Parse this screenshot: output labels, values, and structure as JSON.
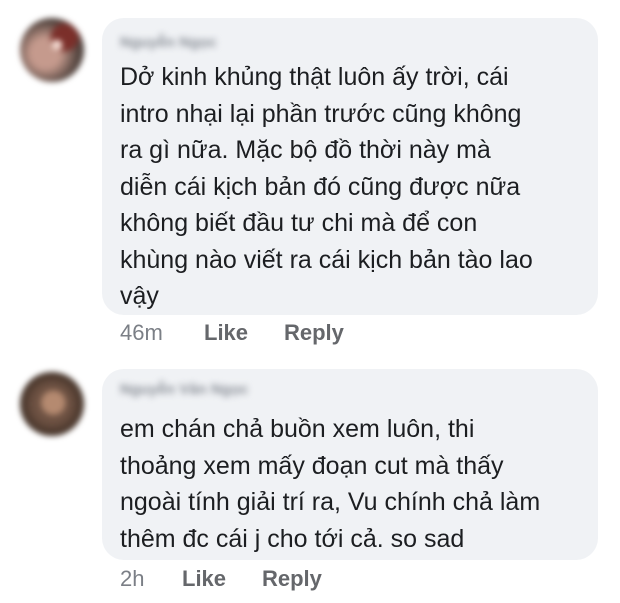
{
  "comments": [
    {
      "author": "Nguyễn Ngọc",
      "text": "Dở kinh khủng thật luôn ấy trời, cái\nintro nhại lại phần trước cũng không\nra gì nữa. Mặc bộ đồ thời này mà\ndiễn cái kịch bản đó cũng được nữa\nkhông biết đầu tư chi mà để con\nkhùng nào viết ra cái kịch bản tào lao\nvậy",
      "time": "46m",
      "like_label": "Like",
      "reply_label": "Reply"
    },
    {
      "author": "Nguyễn Văn Ngọc",
      "text": "em chán chả buồn xem luôn, thi\nthoảng xem mấy đoạn cut mà thấy\nngoài tính giải trí ra, Vu chính chả làm\nthêm đc cái j cho tới cả. so sad",
      "time": "2h",
      "like_label": "Like",
      "reply_label": "Reply"
    }
  ],
  "colors": {
    "bubble_bg": "#f0f2f5",
    "text": "#1c1e21",
    "meta": "#65676b"
  }
}
